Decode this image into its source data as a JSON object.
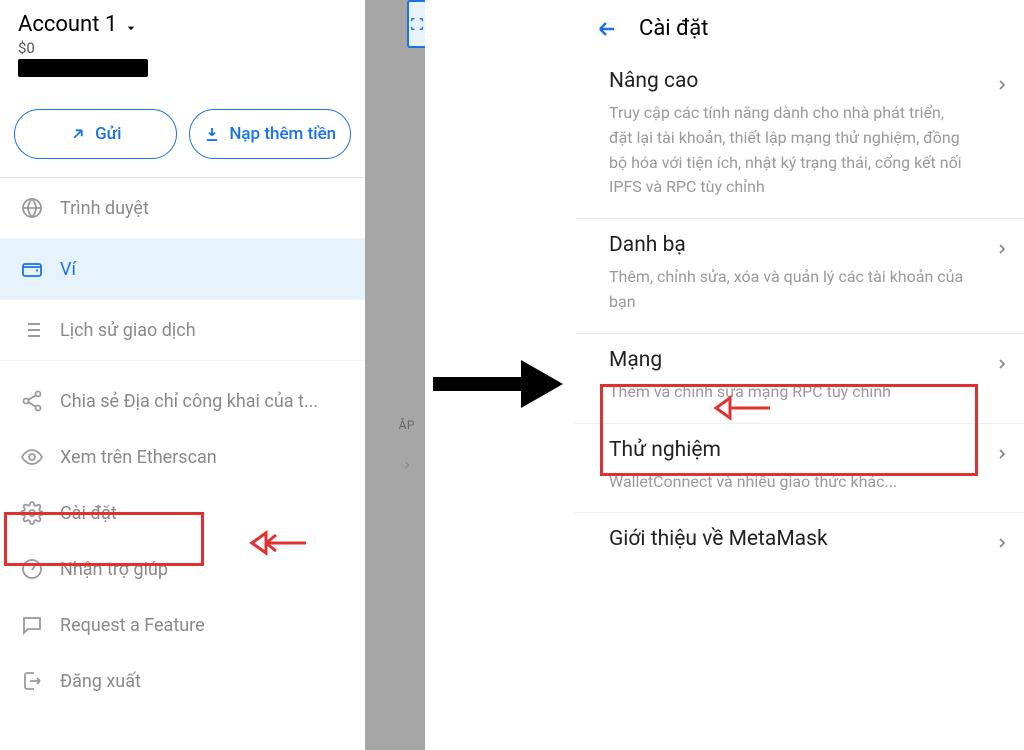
{
  "account": {
    "name": "Account 1",
    "balance": "$0"
  },
  "buttons": {
    "send": "Gửi",
    "buy": "Nạp thêm tiền"
  },
  "menu": {
    "browser": "Trình duyệt",
    "wallet": "Ví",
    "history": "Lịch sử giao dịch",
    "share": "Chia sẻ Địa chỉ công khai của t...",
    "etherscan": "Xem trên Etherscan",
    "settings": "Cài đặt",
    "help": "Nhận trợ giúp",
    "request": "Request a Feature",
    "logout": "Đăng xuất"
  },
  "shade": {
    "label": "ÂP"
  },
  "settings": {
    "header": "Cài đặt",
    "advanced": {
      "title": "Nâng cao",
      "desc": "Truy cập các tính năng dành cho nhà phát triển, đặt lại tài khoản, thiết lập mạng thử nghiệm, đồng bộ hóa với tiện ích, nhật ký trạng thái, cổng kết nối IPFS và RPC tùy chỉnh"
    },
    "contacts": {
      "title": "Danh bạ",
      "desc": "Thêm, chỉnh sửa, xóa và quản lý các tài khoản của bạn"
    },
    "networks": {
      "title": "Mạng",
      "desc": "Thêm và chỉnh sửa mạng RPC tùy chỉnh"
    },
    "experimental": {
      "title": "Thử nghiệm",
      "desc": "WalletConnect và nhiều giao thức khác..."
    },
    "about": {
      "title": "Giới thiệu về MetaMask"
    }
  }
}
